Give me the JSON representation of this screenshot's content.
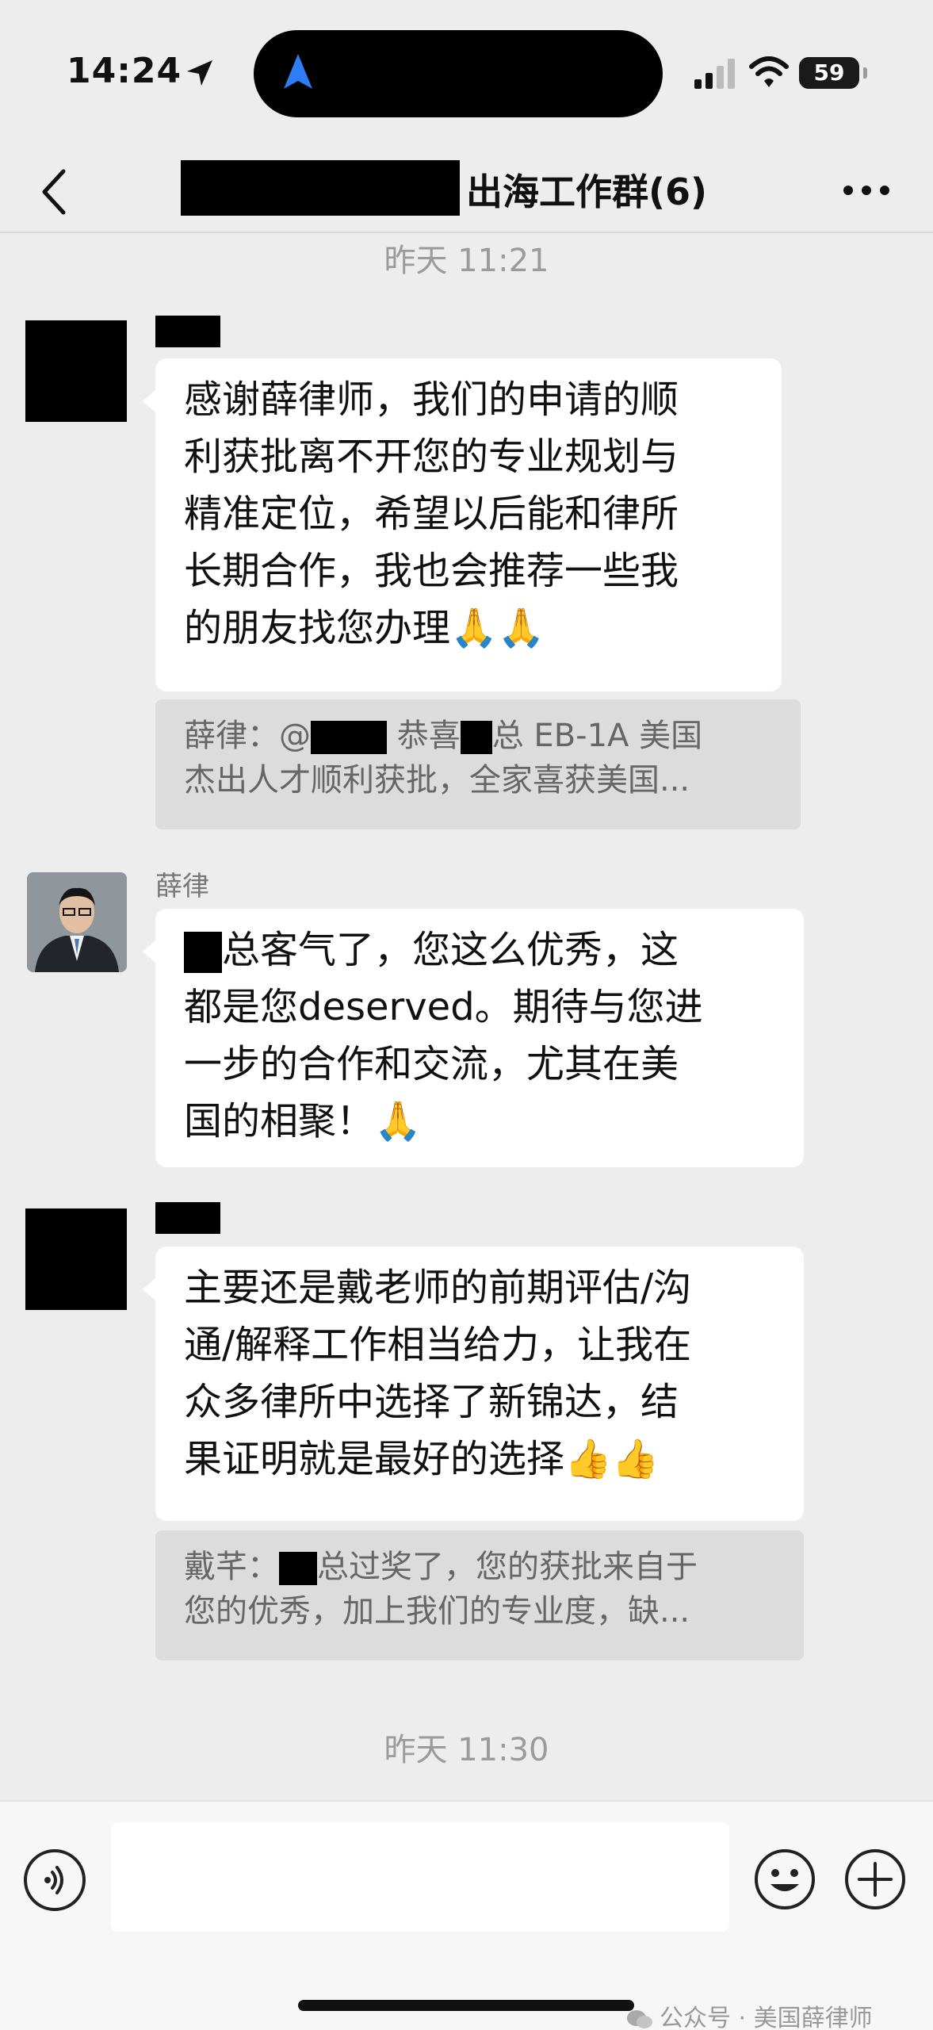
{
  "status_bar": {
    "time": "14:24",
    "battery": "59"
  },
  "header": {
    "title": "出海工作群(6)"
  },
  "messages": {
    "ts1": "昨天 11:21",
    "msg1": {
      "lines": [
        "感谢薛律师，我们的申请的顺",
        "利获批离不开您的专业规划与",
        "精准定位，希望以后能和律所",
        "长期合作，我也会推荐一些我",
        "的朋友找您办理🙏🙏"
      ]
    },
    "quote1": {
      "prefix": "薛律：@",
      "mid": "恭喜",
      "suffix": "总 EB-1A 美国",
      "line2": "杰出人才顺利获批，全家喜获美国..."
    },
    "msg2": {
      "sender": "薛律",
      "line1_suffix": "总客气了，您这么优秀，这",
      "lines": [
        "都是您deserved。期待与您进",
        "一步的合作和交流，尤其在美",
        "国的相聚！🙏"
      ]
    },
    "msg3": {
      "lines": [
        "主要还是戴老师的前期评估/沟",
        "通/解释工作相当给力，让我在",
        "众多律所中选择了新锦达，结",
        "果证明就是最好的选择👍👍"
      ]
    },
    "quote2": {
      "prefix": "戴芊：",
      "suffix": "总过奖了，您的获批来自于",
      "line2": "您的优秀，加上我们的专业度，缺..."
    },
    "ts2": "昨天 11:30"
  },
  "watermark": "公众号 · 美国薛律师",
  "icons": [
    "location-arrow-icon",
    "navigation-icon",
    "signal-icon",
    "wifi-icon",
    "back-icon",
    "more-icon",
    "voice-icon",
    "emoji-icon",
    "plus-icon",
    "wechat-icon"
  ]
}
